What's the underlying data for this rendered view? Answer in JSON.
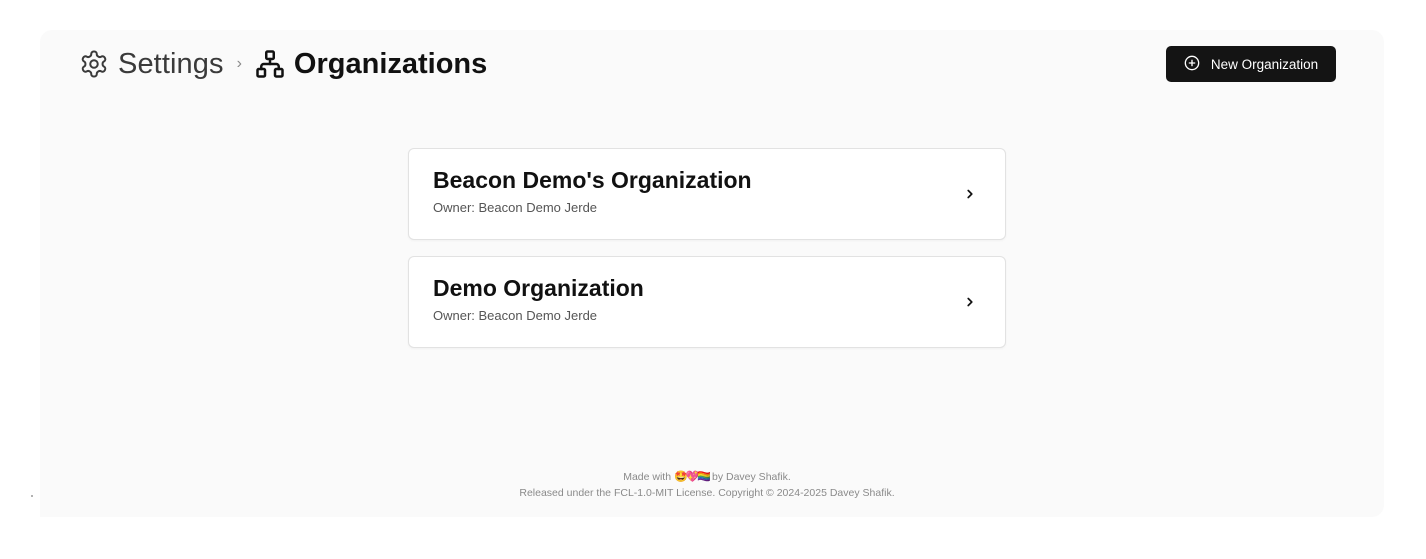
{
  "breadcrumb": {
    "settings_label": "Settings",
    "separator": "›",
    "current_label": "Organizations",
    "settings_icon": "gear-icon",
    "current_icon": "org-chart-icon"
  },
  "actions": {
    "new_org_label": "New Organization",
    "new_org_icon": "plus-circle-icon"
  },
  "organizations": [
    {
      "name": "Beacon Demo's Organization",
      "owner": "Owner: Beacon Demo Jerde"
    },
    {
      "name": "Demo Organization",
      "owner": "Owner: Beacon Demo Jerde"
    }
  ],
  "footer": {
    "made_with_prefix": "Made with",
    "emojis": "🤩💖🏳️‍🌈",
    "made_with_suffix": "by Davey Shafik.",
    "license_line": "Released under the FCL-1.0-MIT License. Copyright © 2024-2025 Davey Shafik."
  },
  "colors": {
    "panel_bg": "#fafafa",
    "button_bg": "#141414",
    "card_border": "#e2e2e2"
  }
}
